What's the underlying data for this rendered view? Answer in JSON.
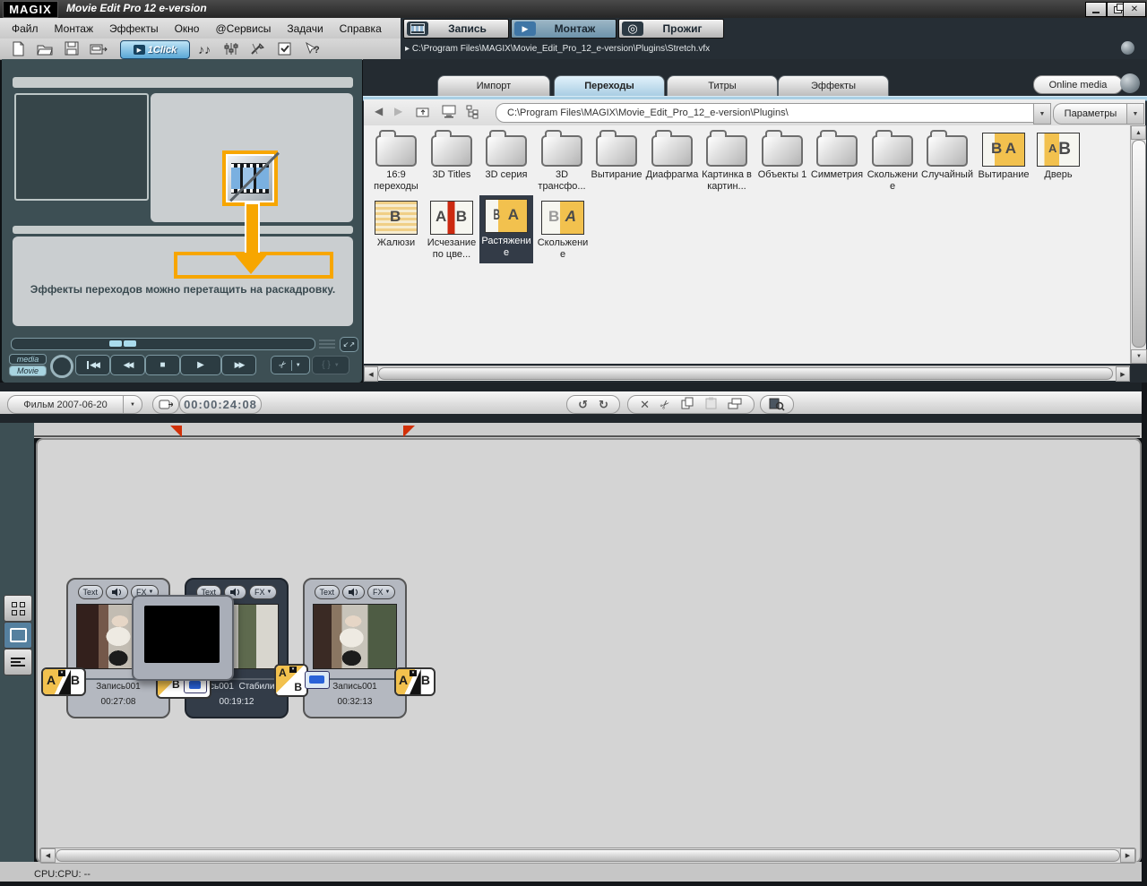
{
  "window": {
    "logo": "MAGIX",
    "title": "Movie Edit Pro 12 e-version"
  },
  "menubar": {
    "items": [
      "Файл",
      "Монтаж",
      "Эффекты",
      "Окно",
      "@Сервисы",
      "Задачи",
      "Справка"
    ]
  },
  "mode_tabs": {
    "record": "Запись",
    "edit": "Монтаж",
    "burn": "Прожиг"
  },
  "toolbar": {
    "oneclick": "1Click",
    "path": "C:\\Program Files\\MAGIX\\Movie_Edit_Pro_12_e-version\\Plugins\\Stretch.vfx"
  },
  "monitor": {
    "hint": "Эффекты переходов можно перетащить на раскадровку.",
    "media": "media",
    "movie": "Movie"
  },
  "media_pool": {
    "tabs": [
      "Импорт",
      "Переходы",
      "Титры",
      "Эффекты"
    ],
    "active_tab": "Переходы",
    "online_media": "Online media",
    "path": "C:\\Program Files\\MAGIX\\Movie_Edit_Pro_12_e-version\\Plugins\\",
    "params": "Параметры",
    "row1": [
      "16:9 переходы",
      "3D Titles",
      "3D серия",
      "3D трансфо...",
      "Вытирание",
      "Диафрагма",
      "Картинка в картин...",
      "Объекты 1",
      "Симметрия",
      "Скольжение",
      "Случайный",
      "Вытирание",
      "Дверь"
    ],
    "row2": [
      "Жалюзи",
      "Исчезание по цве...",
      "Растяжение",
      "Скольжение"
    ],
    "selected": "Растяжение"
  },
  "film_bar": {
    "name": "Фильм 2007-06-20",
    "timecode": "00:00:24:08"
  },
  "storyboard": {
    "clips": [
      {
        "name": "Запись001",
        "duration": "00:27:08"
      },
      {
        "name": "Запись001  Стабилиза",
        "duration": "00:19:12"
      },
      {
        "name": "Запись001",
        "duration": "00:32:13"
      }
    ],
    "clip_text": "Text",
    "clip_fx": "FX"
  },
  "ab": {
    "a": "A",
    "b": "B"
  },
  "status": {
    "cpu": "CPU:CPU: --"
  },
  "icons": {
    "dropdown": "▼",
    "dropdown_small": "▾",
    "up_small": "▲",
    "left": "◀",
    "right": "▶",
    "stop": "■",
    "play": "▶",
    "undo": "↺",
    "redo": "↻",
    "delete": "✕",
    "cut": "✂",
    "path_arrow": "▸",
    "resize": "↙↗",
    "range": "{ }",
    "notes": "♪♪",
    "disc": "◎",
    "help": "?",
    "close": "✕"
  },
  "colors": {
    "accent_orange": "#F7A600",
    "active_tab_blue": "#A9CDE3",
    "selection_dark": "#333B47",
    "transition_yellow": "#F2C14E",
    "slate_panel": "#3D4F54"
  }
}
